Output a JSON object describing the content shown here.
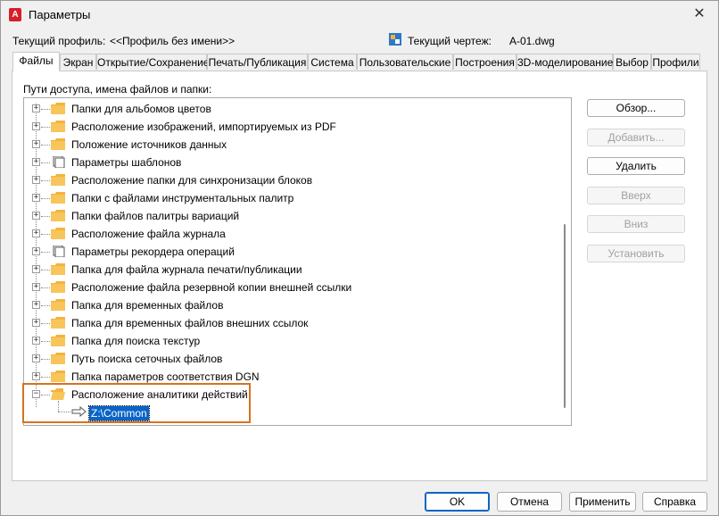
{
  "window": {
    "title": "Параметры",
    "close": "✕"
  },
  "profile": {
    "label": "Текущий профиль:",
    "value": "<<Профиль без имени>>"
  },
  "drawing": {
    "label": "Текущий чертеж:",
    "value": "A-01.dwg"
  },
  "tabs": [
    {
      "label": "Файлы",
      "active": true
    },
    {
      "label": "Экран"
    },
    {
      "label": "Открытие/Сохранение"
    },
    {
      "label": "Печать/Публикация"
    },
    {
      "label": "Система"
    },
    {
      "label": "Пользовательские"
    },
    {
      "label": "Построения"
    },
    {
      "label": "3D-моделирование"
    },
    {
      "label": "Выбор"
    },
    {
      "label": "Профили"
    }
  ],
  "panel": {
    "label": "Пути доступа, имена файлов и папки:"
  },
  "tree": {
    "items": [
      {
        "label": "Папки для альбомов цветов",
        "icon": "folder"
      },
      {
        "label": "Расположение изображений, импортируемых из PDF",
        "icon": "folder"
      },
      {
        "label": "Положение источников данных",
        "icon": "folder"
      },
      {
        "label": "Параметры шаблонов",
        "icon": "pages"
      },
      {
        "label": "Расположение папки для синхронизации блоков",
        "icon": "folder"
      },
      {
        "label": "Папки с файлами инструментальных палитр",
        "icon": "folder"
      },
      {
        "label": "Папки файлов палитры вариаций",
        "icon": "folder"
      },
      {
        "label": "Расположение файла журнала",
        "icon": "folder"
      },
      {
        "label": "Параметры рекордера операций",
        "icon": "pages"
      },
      {
        "label": "Папка для файла журнала печати/публикации",
        "icon": "folder"
      },
      {
        "label": "Расположение файла резервной копии внешней ссылки",
        "icon": "folder"
      },
      {
        "label": "Папка для временных файлов",
        "icon": "folder"
      },
      {
        "label": "Папка для временных файлов внешних ссылок",
        "icon": "folder"
      },
      {
        "label": "Папка для поиска текстур",
        "icon": "folder"
      },
      {
        "label": "Путь поиска сеточных файлов",
        "icon": "folder"
      },
      {
        "label": "Папка параметров соответствия DGN",
        "icon": "folder"
      },
      {
        "label": "Расположение аналитики действий",
        "icon": "folder-open",
        "expanded": true
      }
    ],
    "expanded_child": "Z:\\Common"
  },
  "side_buttons": {
    "browse": "Обзор...",
    "add": "Добавить...",
    "remove": "Удалить",
    "up": "Вверх",
    "down": "Вниз",
    "set": "Установить"
  },
  "bottom_buttons": {
    "ok": "OK",
    "cancel": "Отмена",
    "apply": "Применить",
    "help": "Справка"
  },
  "colors": {
    "accent": "#0a64c8",
    "highlight_border": "#d6731e",
    "folder": "#f3b33d"
  }
}
